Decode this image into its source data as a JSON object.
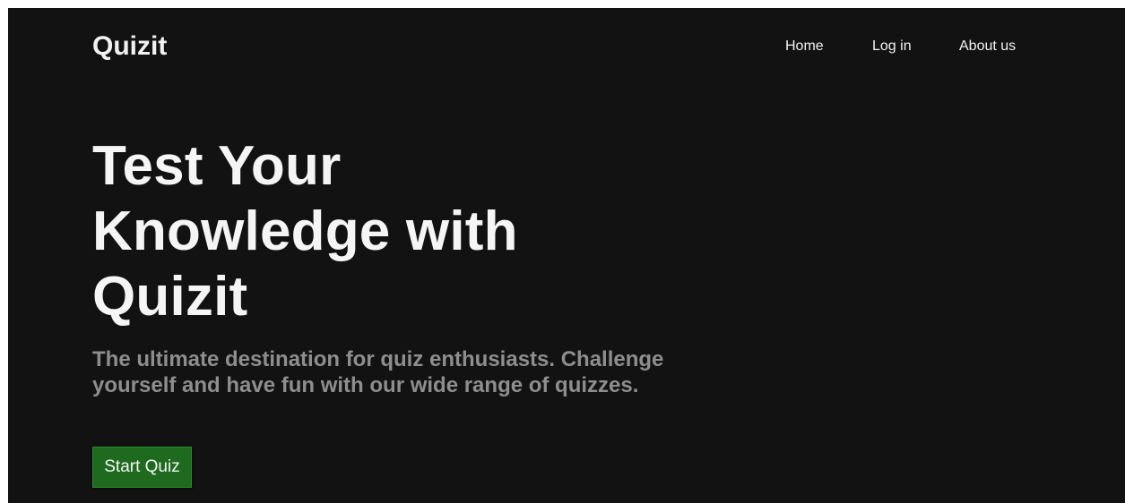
{
  "navbar": {
    "brand": "Quizit",
    "links": [
      {
        "label": "Home"
      },
      {
        "label": "Log in"
      },
      {
        "label": "About us"
      }
    ]
  },
  "hero": {
    "title": "Test Your Knowledge with Quizit",
    "subtitle": "The ultimate destination for quiz enthusiasts. Challenge yourself and have fun with our wide range of quizzes.",
    "cta_label": "Start Quiz"
  },
  "colors": {
    "background": "#121212",
    "text": "#f5f5f5",
    "subtitle": "#8e8e8e",
    "button": "#1e6a1e"
  }
}
